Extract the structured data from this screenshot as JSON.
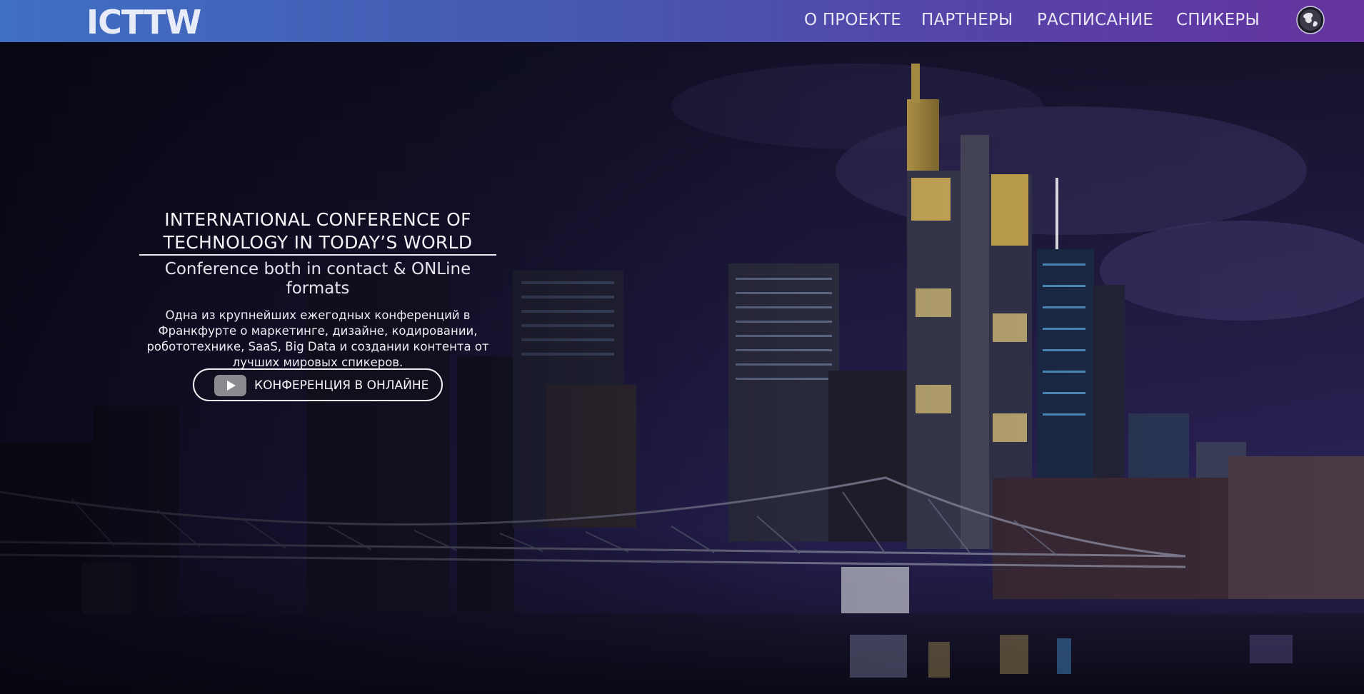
{
  "header": {
    "logo": "ICTTW",
    "nav": [
      {
        "label": "О ПРОЕКТЕ"
      },
      {
        "label": "ПАРТНЕРЫ"
      },
      {
        "label": "РАСПИСАНИЕ"
      },
      {
        "label": "СПИКЕРЫ"
      }
    ],
    "language_icon": "globe-icon",
    "gradient": [
      "#3f6fc2",
      "#6633a0"
    ]
  },
  "hero": {
    "background_image": "Frankfurt skyline at night with bridge over the river",
    "title": "INTERNATIONAL CONFERENCE OF TECHNOLOGY IN TODAY’S WORLD",
    "subtitle": "Conference both in contact & ONLine formats",
    "description": "Одна из крупнейших ежегодных конференций в Франкфурте о маркетинге, дизайне, кодировании, робототехнике, SaaS, Big Data и создании контента от лучших мировых спикеров.",
    "cta": {
      "label": "КОНФЕРЕНЦИЯ В ОНЛАЙНЕ",
      "icon": "play-icon"
    }
  }
}
